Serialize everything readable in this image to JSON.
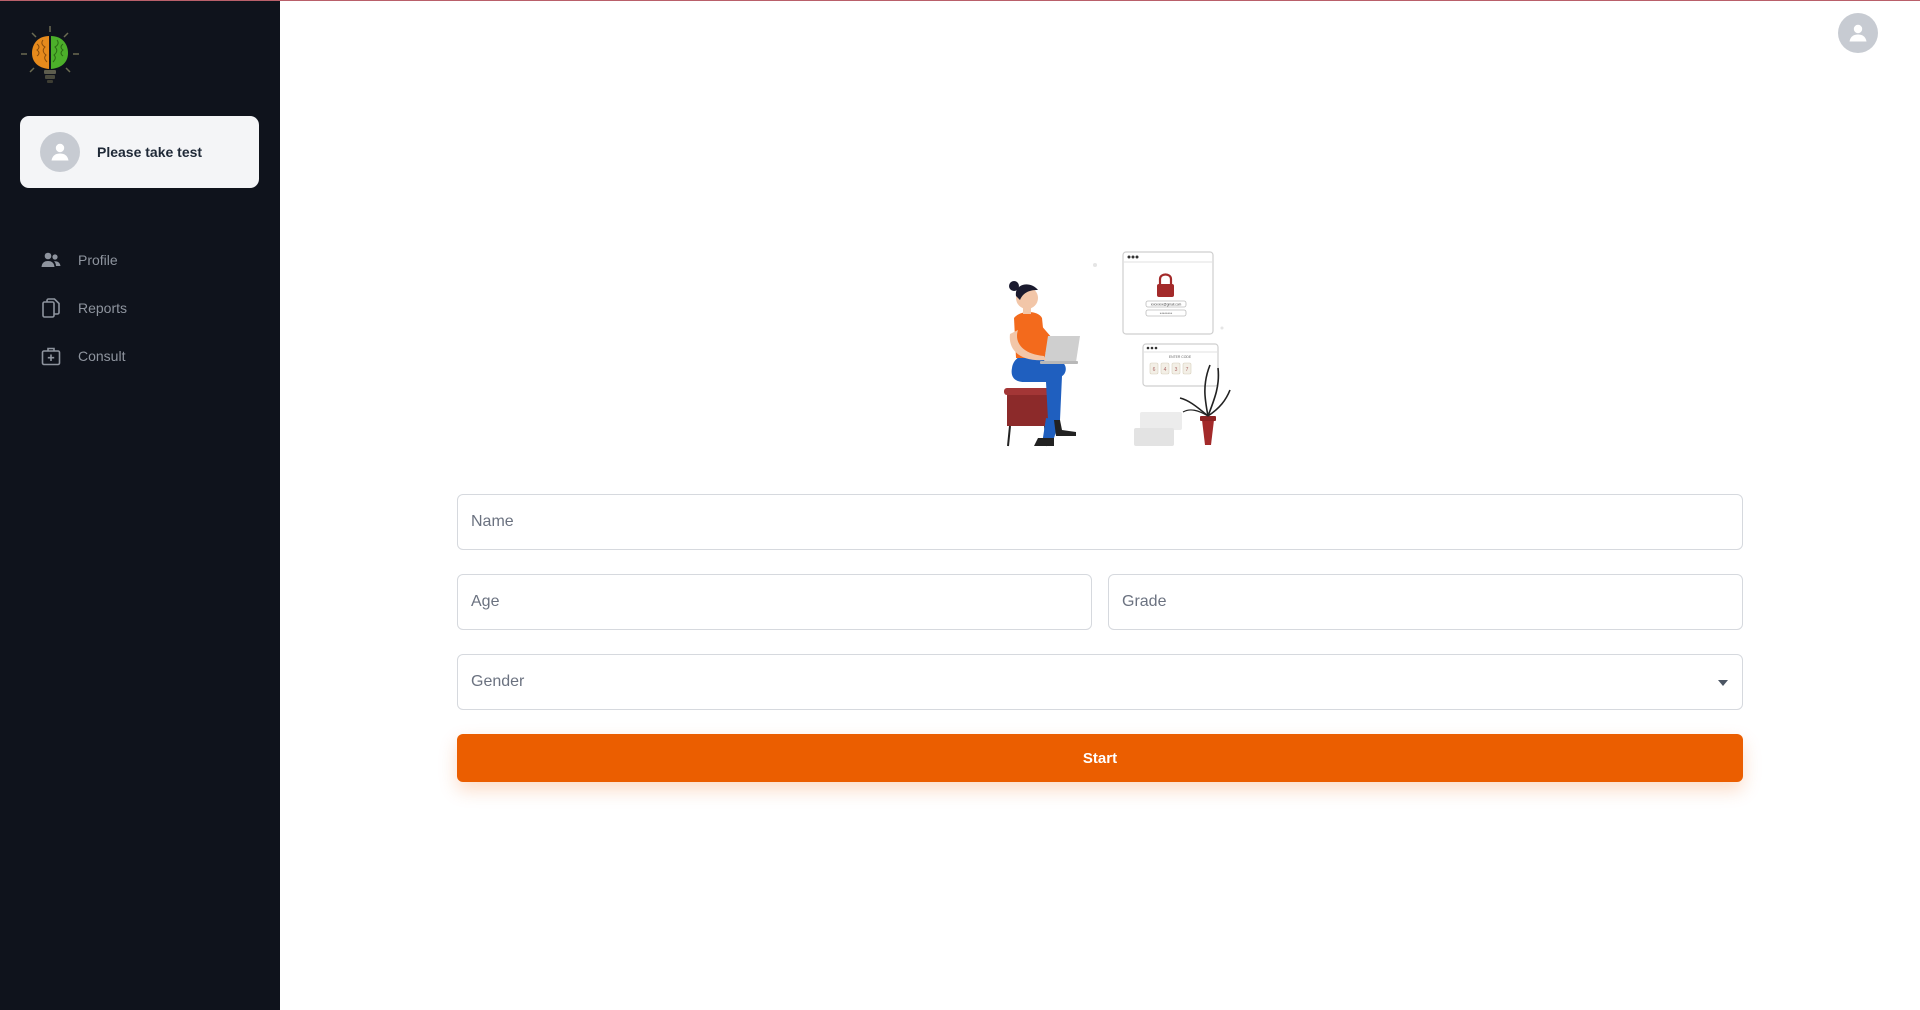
{
  "sidebar": {
    "logo_icon": "brain-bulb-logo",
    "user_card": {
      "label": "Please take test",
      "icon": "user-avatar-icon"
    },
    "items": [
      {
        "label": "Profile",
        "icon": "users-icon"
      },
      {
        "label": "Reports",
        "icon": "documents-icon"
      },
      {
        "label": "Consult",
        "icon": "medical-kit-icon"
      }
    ]
  },
  "header": {
    "avatar_icon": "user-avatar-icon"
  },
  "form": {
    "name_placeholder": "Name",
    "age_placeholder": "Age",
    "grade_placeholder": "Grade",
    "gender_placeholder": "Gender",
    "start_label": "Start"
  },
  "illustration": {
    "login_email": "xxxxxxxx@gmail.com",
    "code_title": "ENTER CODE",
    "code_digits": [
      "6",
      "4",
      "3",
      "7"
    ]
  },
  "colors": {
    "sidebar_bg": "#0f131c",
    "accent": "#eb5e00",
    "user_card_bg": "#f4f5f7"
  }
}
